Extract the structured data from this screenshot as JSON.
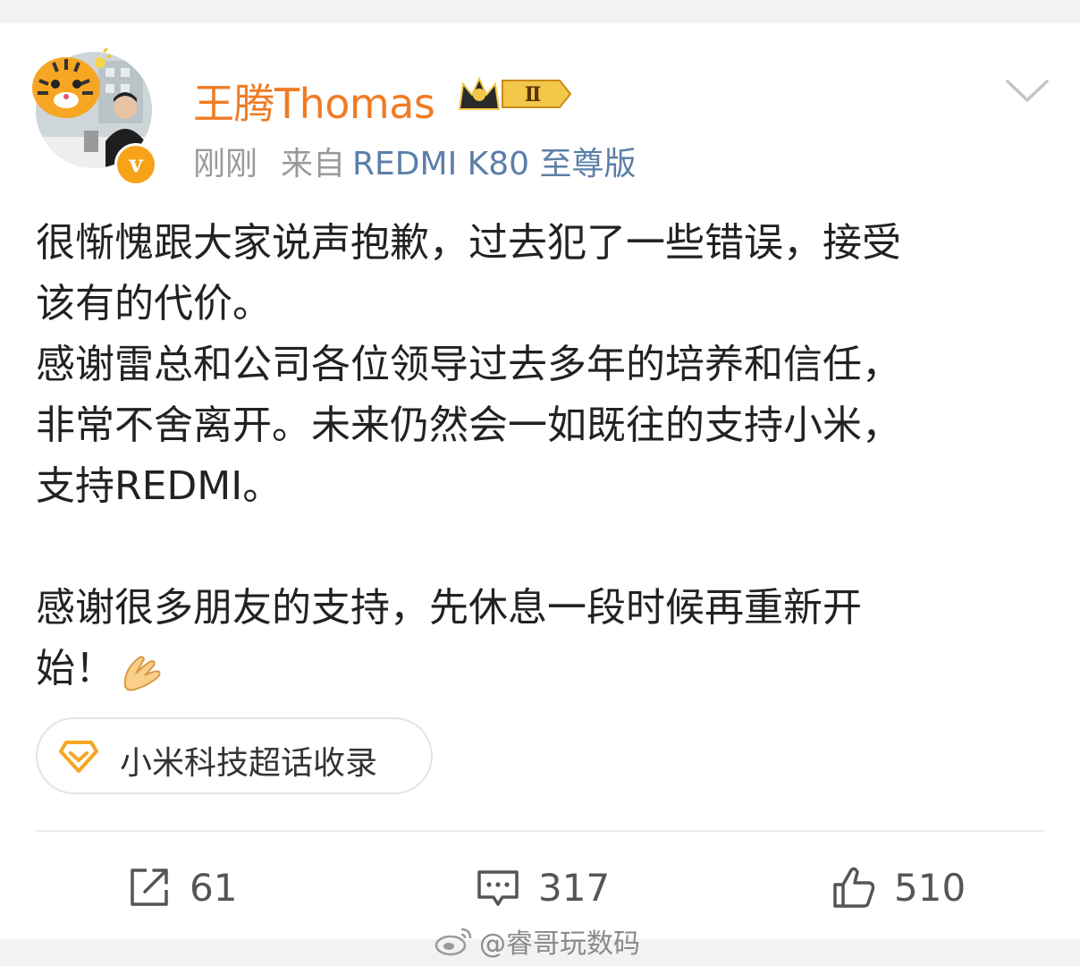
{
  "post": {
    "author": "王腾Thomas",
    "membership_badge": "Ⅱ",
    "verified_mark": "v",
    "timestamp": "刚刚",
    "source_label": "来自",
    "source_device": "REDMI K80 至尊版",
    "body_lines": [
      "很惭愧跟大家说声抱歉，过去犯了一些错误，接受",
      "该有的代价。",
      "感谢雷总和公司各位领导过去多年的培养和信任，",
      "非常不舍离开。未来仍然会一如既往的支持小米，",
      "支持REDMI。",
      "",
      "感谢很多朋友的支持，先休息一段时候再重新开",
      "始！"
    ],
    "topic": "小米科技超话收录"
  },
  "actions": {
    "repost_count": "61",
    "comment_count": "317",
    "like_count": "510"
  },
  "watermark": "@睿哥玩数码",
  "icons": [
    "tiger-sticker-icon",
    "verified-icon",
    "crown-badge-icon",
    "chevron-down-icon",
    "hands-emoji-icon",
    "diamond-topic-icon",
    "repost-icon",
    "comment-icon",
    "like-icon",
    "weibo-logo-icon"
  ],
  "colors": {
    "username": "#f07b23",
    "device_link": "#5b7fa8",
    "verified": "#f7a31a",
    "text": "#222222",
    "meta": "#9a9a9a"
  }
}
